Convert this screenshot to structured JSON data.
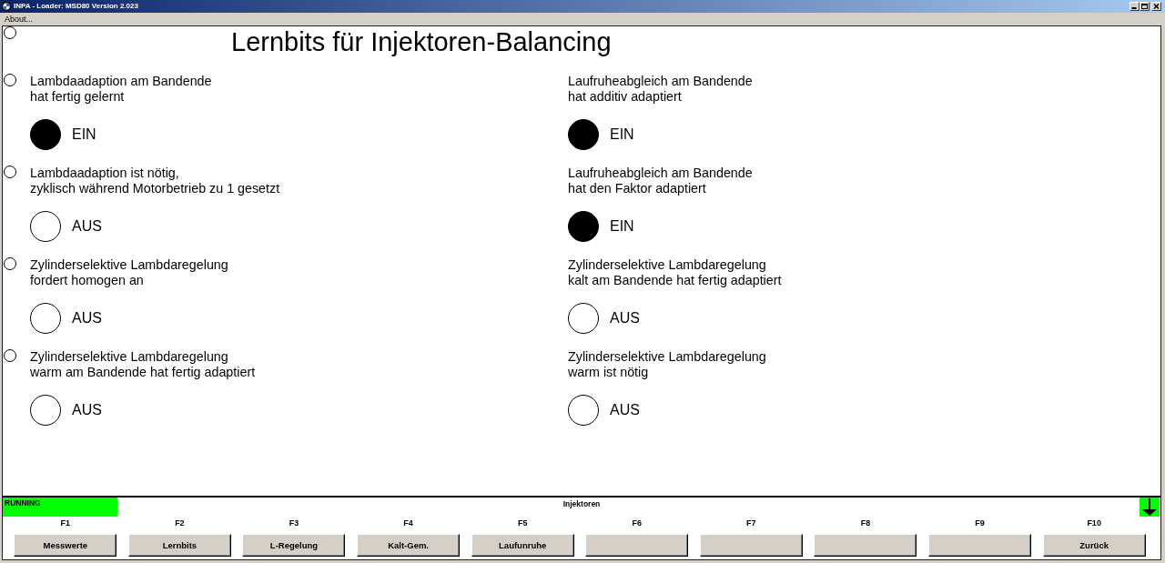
{
  "window": {
    "title": "INPA - Loader: MSD80 Version 2.023"
  },
  "menu": [
    {
      "label": "About..."
    }
  ],
  "header": {
    "title": "Lernbits für Injektoren-Balancing",
    "selected": false
  },
  "rows": [
    {
      "selected": false,
      "cells": [
        {
          "label": "Lambdaadaption am Bandende\nhat fertig gelernt",
          "on": true,
          "state": "EIN"
        },
        {
          "label": "Laufruheabgleich am Bandende\nhat additiv adaptiert",
          "on": true,
          "state": "EIN"
        }
      ]
    },
    {
      "selected": false,
      "cells": [
        {
          "label": "Lambdaadaption ist nötig,\nzyklisch während Motorbetrieb zu 1 gesetzt",
          "on": false,
          "state": "AUS"
        },
        {
          "label": "Laufruheabgleich am Bandende\nhat den Faktor adaptiert",
          "on": true,
          "state": "EIN"
        }
      ]
    },
    {
      "selected": false,
      "cells": [
        {
          "label": "Zylinderselektive Lambdaregelung\nfordert homogen an",
          "on": false,
          "state": "AUS"
        },
        {
          "label": "Zylinderselektive Lambdaregelung\nkalt am Bandende hat fertig adaptiert",
          "on": false,
          "state": "AUS"
        }
      ]
    },
    {
      "selected": false,
      "cells": [
        {
          "label": "Zylinderselektive Lambdaregelung\nwarm am Bandende hat fertig adaptiert",
          "on": false,
          "state": "AUS"
        },
        {
          "label": "Zylinderselektive Lambdaregelung\nwarm ist nötig",
          "on": false,
          "state": "AUS"
        }
      ]
    }
  ],
  "status_bar": {
    "status": "RUNNING",
    "title": "Injektoren"
  },
  "function_keys": [
    {
      "key": "F1",
      "label": "Messwerte"
    },
    {
      "key": "F2",
      "label": "Lernbits"
    },
    {
      "key": "F3",
      "label": "L-Regelung"
    },
    {
      "key": "F4",
      "label": "Kalt-Gem."
    },
    {
      "key": "F5",
      "label": "Laufunruhe"
    },
    {
      "key": "F6"
    },
    {
      "key": "F7"
    },
    {
      "key": "F8"
    },
    {
      "key": "F9"
    },
    {
      "key": "F10",
      "label": "Zurück"
    }
  ]
}
